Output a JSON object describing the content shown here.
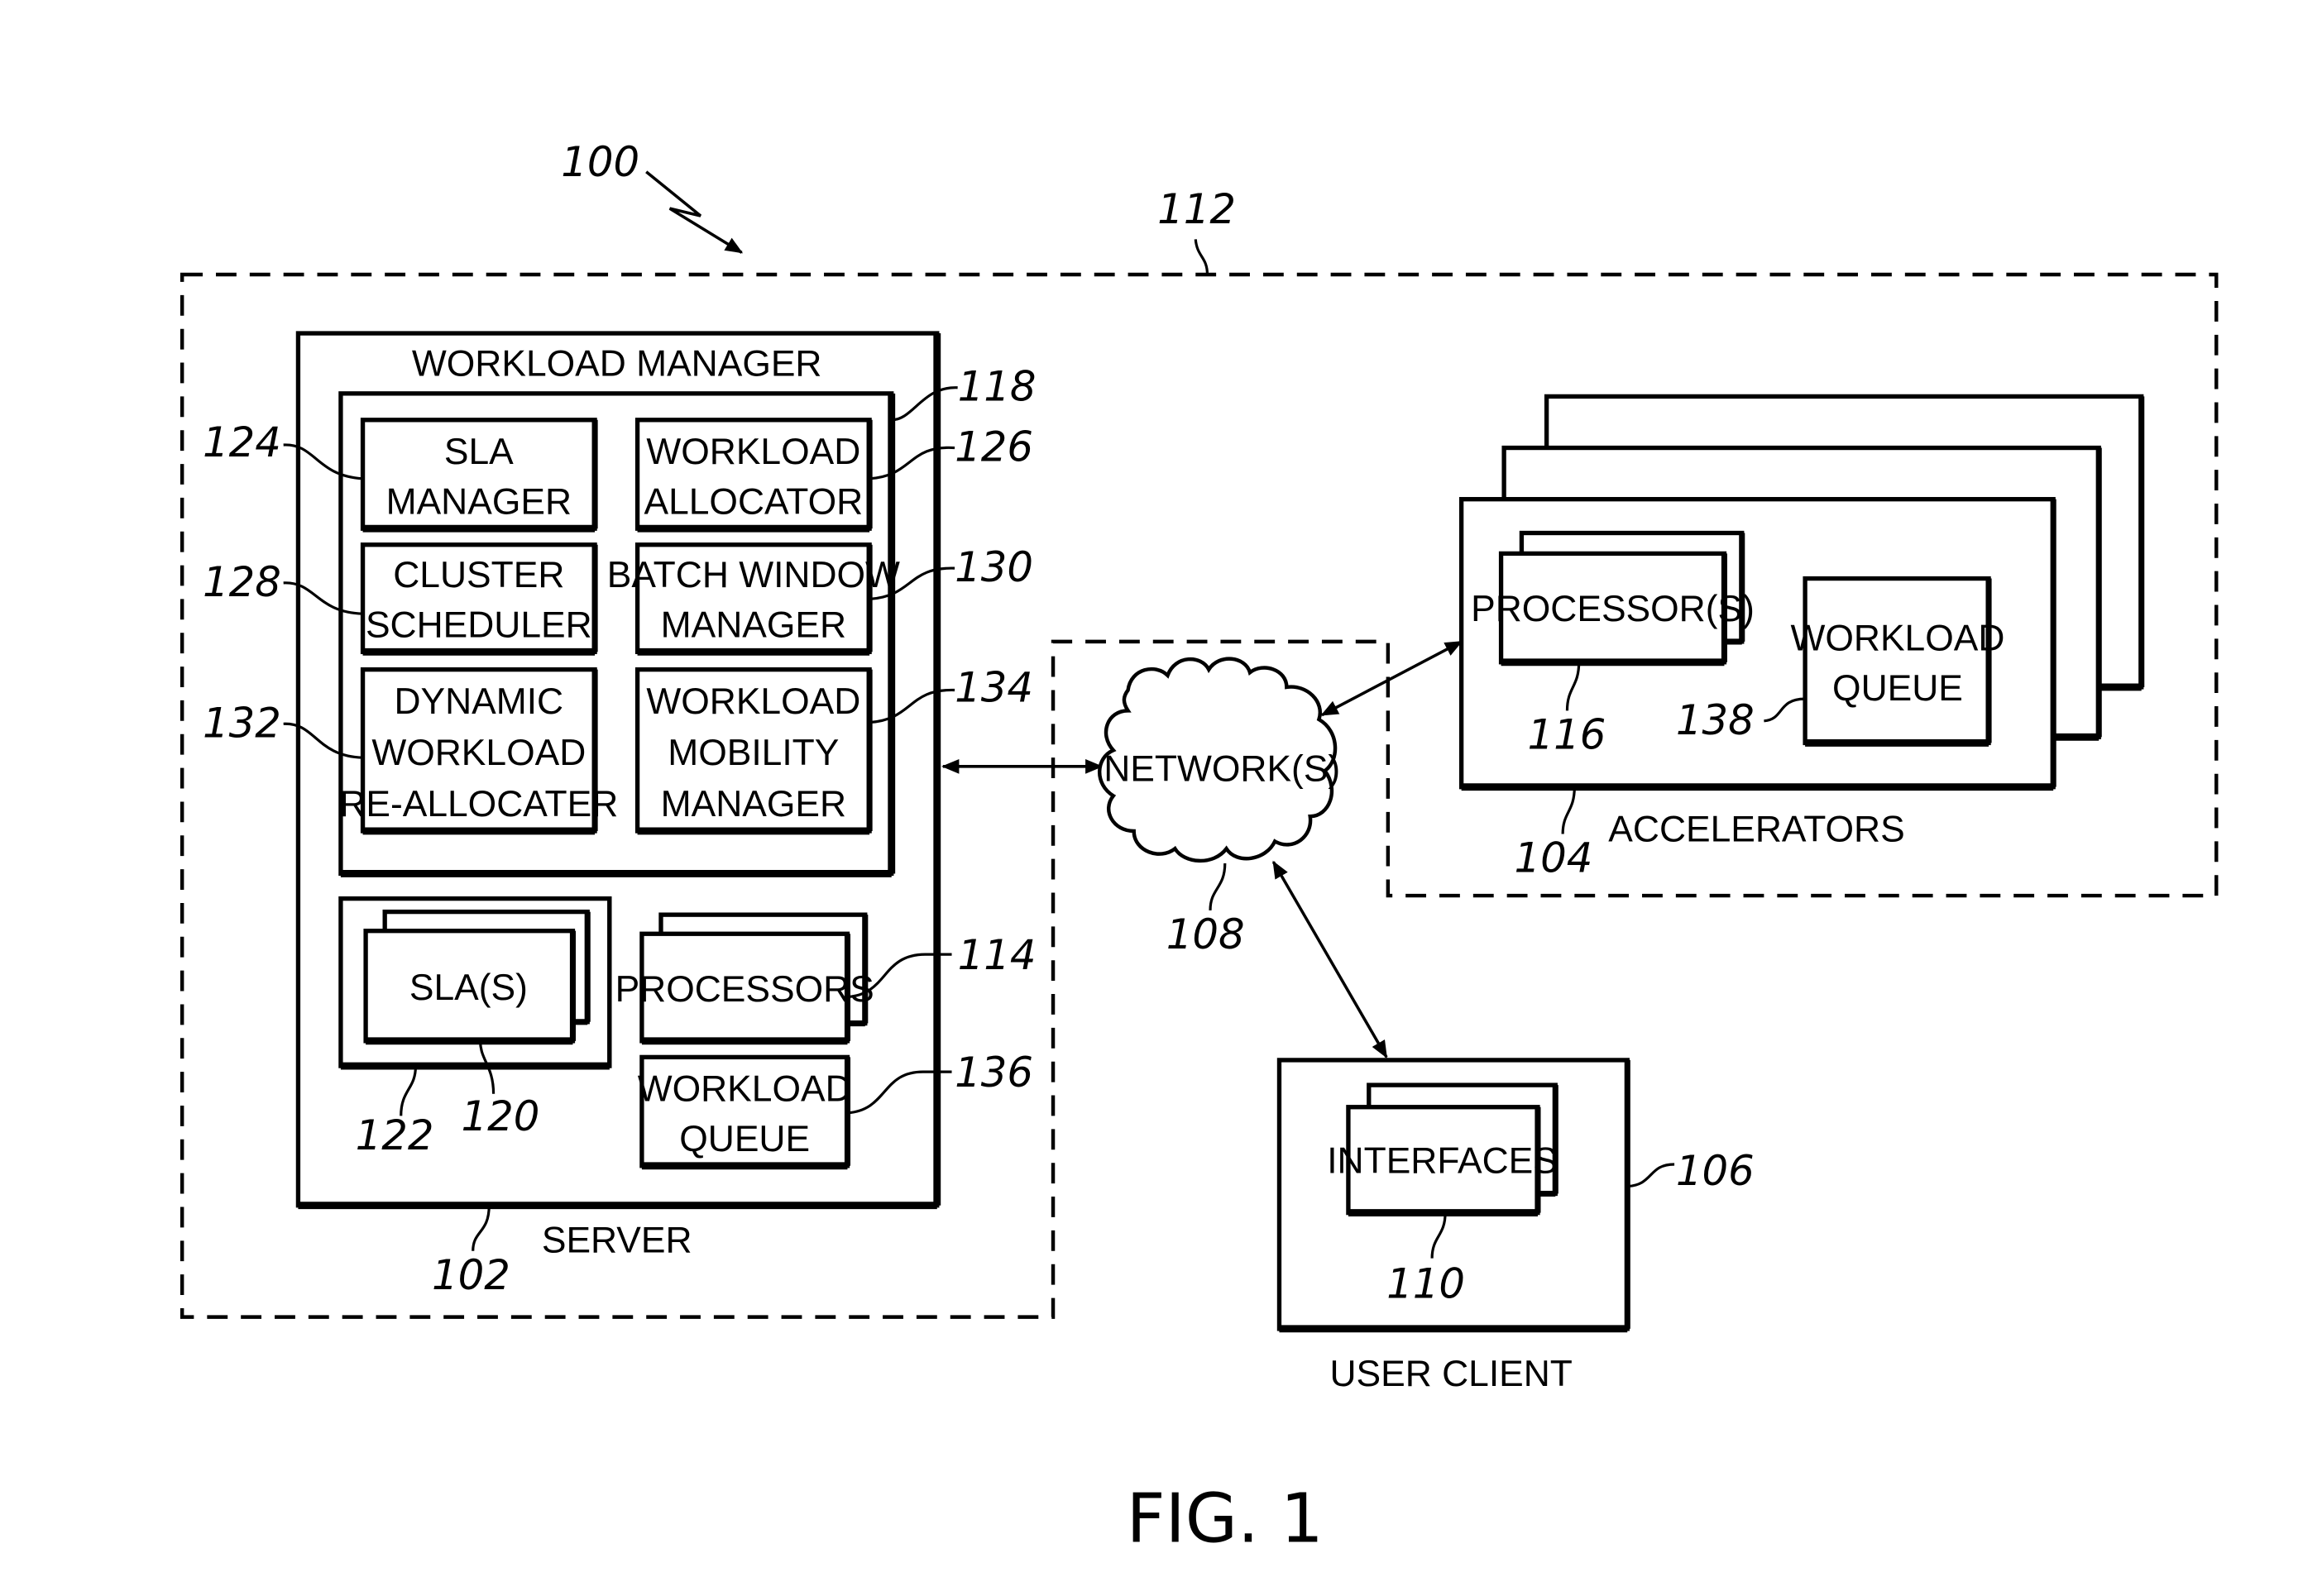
{
  "figure": {
    "label": "FIG. 1",
    "system_ref": "100",
    "boundary_ref": "112"
  },
  "server": {
    "ref": "102",
    "label": "SERVER",
    "workload_manager": {
      "ref": "118",
      "title": "WORKLOAD MANAGER",
      "modules": [
        {
          "ref": "124",
          "lines": [
            "SLA",
            "MANAGER"
          ]
        },
        {
          "ref": "126",
          "lines": [
            "WORKLOAD",
            "ALLOCATOR"
          ]
        },
        {
          "ref": "128",
          "lines": [
            "CLUSTER",
            "SCHEDULER"
          ]
        },
        {
          "ref": "130",
          "lines": [
            "BATCH WINDOW",
            "MANAGER"
          ]
        },
        {
          "ref": "132",
          "lines": [
            "DYNAMIC",
            "WORKLOAD",
            "RE-ALLOCATER"
          ]
        },
        {
          "ref": "134",
          "lines": [
            "WORKLOAD",
            "MOBILITY",
            "MANAGER"
          ]
        }
      ]
    },
    "slas": {
      "outer_ref": "122",
      "inner_ref": "120",
      "label": "SLA(S)"
    },
    "processors": {
      "ref": "114",
      "label": "PROCESSORS"
    },
    "workload_queue": {
      "ref": "136",
      "lines": [
        "WORKLOAD",
        "QUEUE"
      ]
    }
  },
  "network": {
    "ref": "108",
    "label": "NETWORK(S)"
  },
  "accelerators": {
    "ref": "104",
    "label": "ACCELERATORS",
    "processors": {
      "ref": "116",
      "label": "PROCESSOR(S)"
    },
    "workload_queue": {
      "ref": "138",
      "lines": [
        "WORKLOAD",
        "QUEUE"
      ]
    }
  },
  "user_client": {
    "ref": "106",
    "label": "USER CLIENT",
    "interfaces": {
      "ref": "110",
      "label": "INTERFACES"
    }
  }
}
